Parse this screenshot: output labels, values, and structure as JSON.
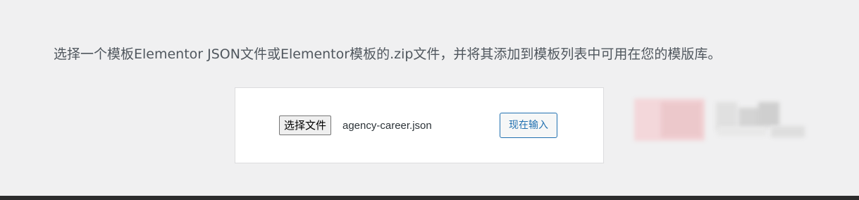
{
  "instructions": "选择一个模板Elementor JSON文件或Elementor模板的.zip文件，并将其添加到模板列表中可用在您的模版库。",
  "upload": {
    "choose_file_label": "选择文件",
    "file_name": "agency-career.json",
    "import_label": "现在输入"
  },
  "colors": {
    "background": "#f0f0f1",
    "panel": "#ffffff",
    "accent": "#2271b1"
  }
}
